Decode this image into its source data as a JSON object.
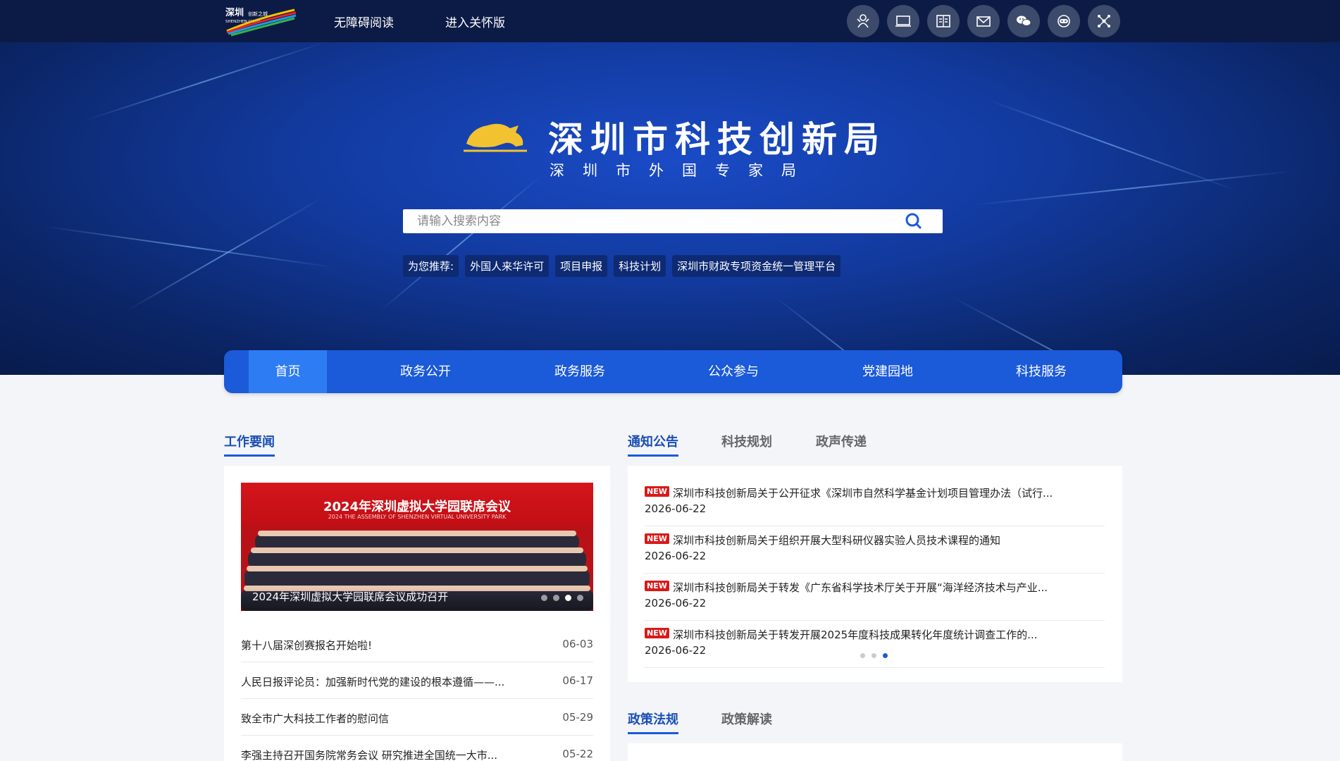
{
  "topbar": {
    "logo_alt": "深圳 SHENZHEN CHINA",
    "accessibility_label": "无障碍阅读",
    "elderly_label": "进入关怀版",
    "icons": [
      "robot-icon",
      "monitor-icon",
      "id-card-icon",
      "mail-icon",
      "wechat-icon",
      "chat-bot-icon",
      "network-icon"
    ]
  },
  "hero": {
    "title": "深圳市科技创新局",
    "subtitle": "深圳市外国专家局",
    "search_placeholder": "请输入搜索内容",
    "recommend_label": "为您推荐:",
    "recommend_links": [
      "外国人来华许可",
      "项目申报",
      "科技计划",
      "深圳市财政专项资金统一管理平台"
    ]
  },
  "nav": {
    "items": [
      "首页",
      "政务公开",
      "政务服务",
      "公众参与",
      "党建园地",
      "科技服务"
    ],
    "active": "首页"
  },
  "work_news": {
    "title": "工作要闻",
    "photo_banner": "2024年深圳虚拟大学园联席会议",
    "photo_banner_sub": "2024 THE ASSEMBLY OF SHENZHEN VIRTUAL UNIVERSITY PARK",
    "photo_caption": "2024年深圳虚拟大学园联席会议成功召开",
    "items": [
      {
        "text": "第十八届深创赛报名开始啦!",
        "date": "06-03"
      },
      {
        "text": "人民日报评论员：加强新时代党的建设的根本遵循——...",
        "date": "06-17"
      },
      {
        "text": "致全市广大科技工作者的慰问信",
        "date": "05-29"
      },
      {
        "text": "李强主持召开国务院常务会议 研究推进全国统一大市...",
        "date": "05-22"
      }
    ]
  },
  "notices": {
    "tabs": [
      "通知公告",
      "科技规划",
      "政声传递"
    ],
    "active_tab": "通知公告",
    "badge": "NEW",
    "items": [
      {
        "text": "深圳市科技创新局关于公开征求《深圳市自然科学基金计划项目管理办法（试行...",
        "date": "2026-06-22"
      },
      {
        "text": "深圳市科技创新局关于组织开展大型科研仪器实验人员技术课程的通知",
        "date": "2026-06-22"
      },
      {
        "text": "深圳市科技创新局关于转发《广东省科学技术厅关于开展“海洋经济技术与产业...",
        "date": "2026-06-22"
      },
      {
        "text": "深圳市科技创新局关于转发开展2025年度科技成果转化年度统计调查工作的...",
        "date": "2026-06-22"
      }
    ],
    "page": 3,
    "pages": 3
  },
  "policy": {
    "tabs": [
      "政策法规",
      "政策解读"
    ],
    "active_tab": "政策法规"
  },
  "colors": {
    "accent": "#1b5ad9",
    "topbar": "#0c1b45",
    "new_badge": "#d71a1a"
  }
}
